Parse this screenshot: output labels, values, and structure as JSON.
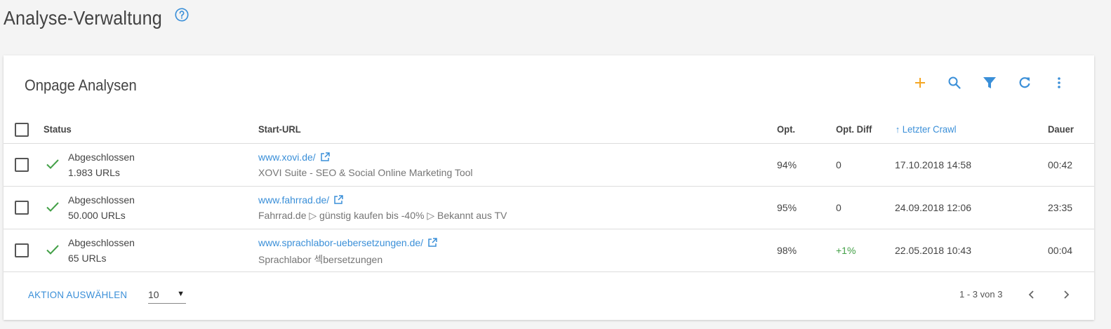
{
  "page": {
    "title": "Analyse-Verwaltung"
  },
  "card": {
    "title": "Onpage Analysen"
  },
  "colors": {
    "accent": "#3a8fd8",
    "add": "#f5a623",
    "success": "#43a047"
  },
  "toolbar": {
    "icons": [
      "add-icon",
      "search-icon",
      "filter-icon",
      "refresh-icon",
      "more-vert-icon"
    ]
  },
  "table": {
    "headers": {
      "status": "Status",
      "start_url": "Start-URL",
      "opt": "Opt.",
      "opt_diff": "Opt. Diff",
      "last_crawl": "Letzter Crawl",
      "duration": "Dauer"
    },
    "sort_arrow": "↑",
    "rows": [
      {
        "status": "Abgeschlossen",
        "urls": "1.983 URLs",
        "url": "www.xovi.de/",
        "desc": "XOVI Suite - SEO & Social Online Marketing Tool",
        "opt": "94%",
        "diff": "0",
        "date": "17.10.2018 14:58",
        "duration": "00:42"
      },
      {
        "status": "Abgeschlossen",
        "urls": "50.000 URLs",
        "url": "www.fahrrad.de/",
        "desc": "Fahrrad.de ▷ günstig kaufen bis -40% ▷ Bekannt aus TV",
        "opt": "95%",
        "diff": "0",
        "date": "24.09.2018 12:06",
        "duration": "23:35"
      },
      {
        "status": "Abgeschlossen",
        "urls": "65 URLs",
        "url": "www.sprachlabor-uebersetzungen.de/",
        "desc": "Sprachlabor 섹bersetzungen",
        "opt": "98%",
        "diff": "+1%",
        "date": "22.05.2018 10:43",
        "duration": "00:04"
      }
    ]
  },
  "footer": {
    "action_label": "AKTION AUSWÄHLEN",
    "per_page": "10",
    "caret": "▼",
    "range": "1 - 3 von 3"
  }
}
